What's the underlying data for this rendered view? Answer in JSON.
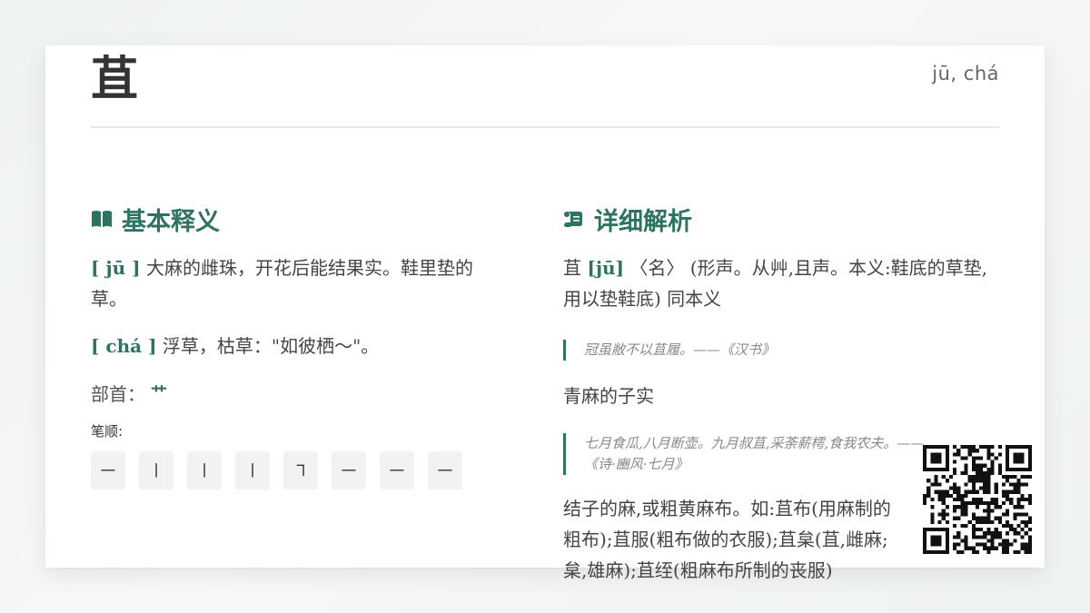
{
  "entry": {
    "character": "苴",
    "pinyin": "jū, chá"
  },
  "basic": {
    "title": "基本释义",
    "icon": "book-open-icon",
    "definitions": [
      {
        "pinyin": "[ jū ]",
        "text": "大麻的雌珠，开花后能结果实。鞋里垫的草。"
      },
      {
        "pinyin": "[ chá ]",
        "text": "浮草，枯草：\"如彼栖～\"。"
      }
    ],
    "radical_label": "部首：",
    "radical": "艹",
    "strokes_label": "笔顺:",
    "strokes": [
      "㇐",
      "㇑",
      "㇑",
      "㇑",
      "㇕",
      "㇐",
      "㇐",
      "㇐"
    ]
  },
  "detail": {
    "title": "详细解析",
    "icon": "scroll-icon",
    "para1_head": "苴",
    "para1_pinyin": "[jū]",
    "para1_text": "〈名〉 (形声。从艸,且声。本义:鞋底的草垫,用以垫鞋底) 同本义",
    "quote1": "冠虽敝不以苴履。——《汉书》",
    "plain": "青麻的子实",
    "quote2": "七月食瓜,八月断壶。九月叔苴,采荼薪樗,食我农夫。——《诗·豳风·七月》",
    "para3": "结子的麻,或粗黄麻布。如:苴布(用麻制的粗布);苴服(粗布做的衣服);苴枲(苴,雌麻;枲,雄麻);苴绖(粗麻布所制的丧服)"
  },
  "qr_icon": "qr-code-icon"
}
